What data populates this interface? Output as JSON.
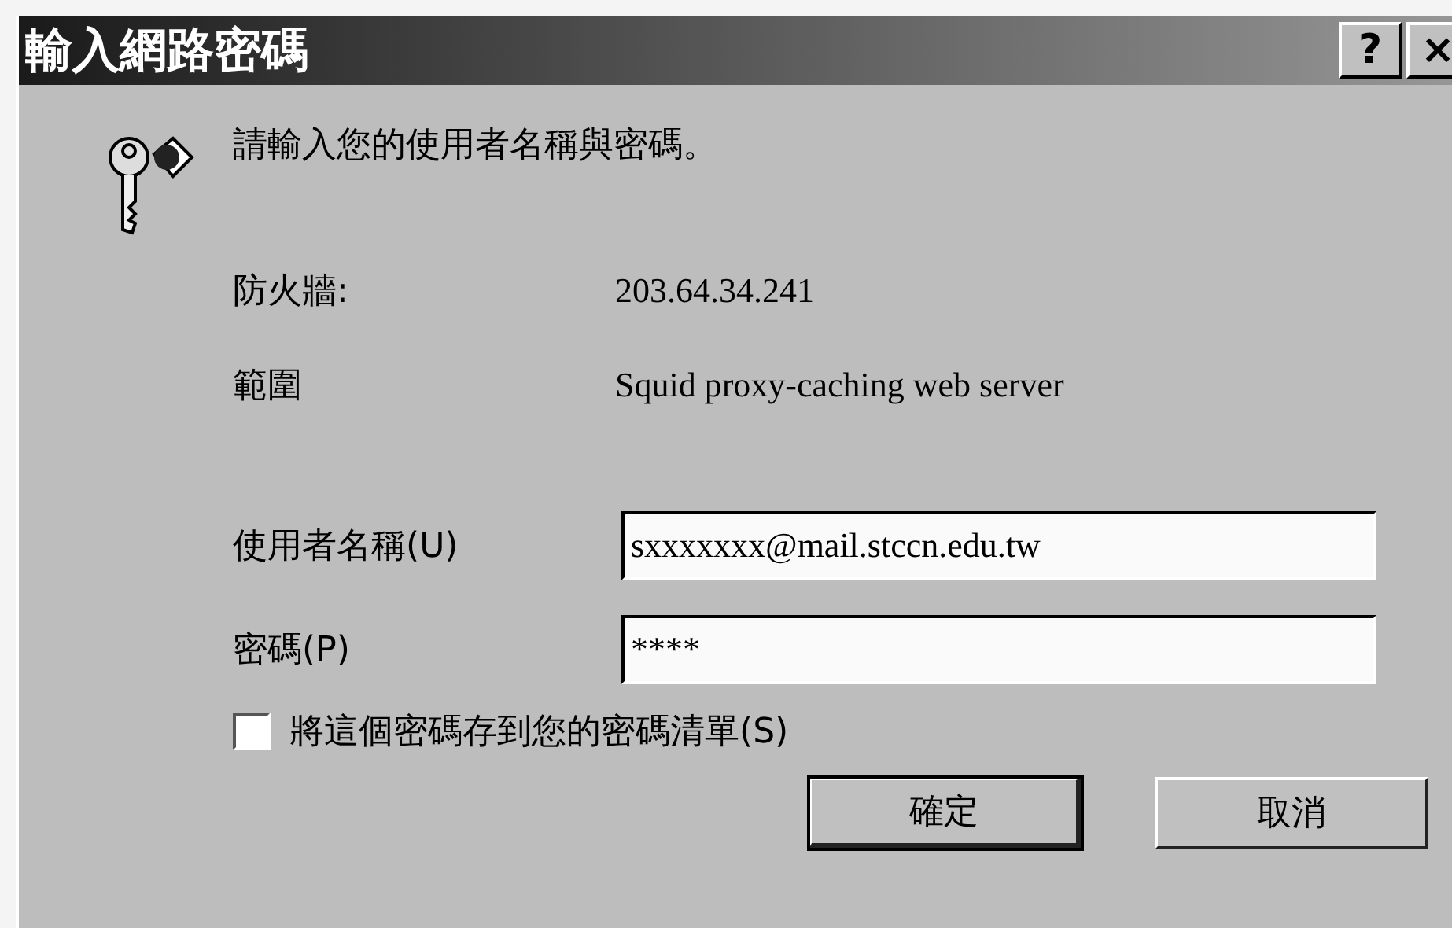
{
  "window": {
    "title": "輸入網路密碼",
    "help_button": "?",
    "close_button": "×"
  },
  "prompt": "請輸入您的使用者名稱與密碼。",
  "info": [
    {
      "label": "防火牆:",
      "value": "203.64.34.241"
    },
    {
      "label": "範圍",
      "value": "Squid proxy-caching web server"
    }
  ],
  "fields": [
    {
      "label": "使用者名稱(U)",
      "value": "sxxxxxxx@mail.stccn.edu.tw"
    },
    {
      "label": "密碼(P)",
      "value": "****"
    }
  ],
  "save_password": {
    "label": "將這個密碼存到您的密碼清單(S)",
    "checked": false
  },
  "buttons": [
    {
      "label": "確定",
      "default": true
    },
    {
      "label": "取消",
      "default": false
    }
  ]
}
